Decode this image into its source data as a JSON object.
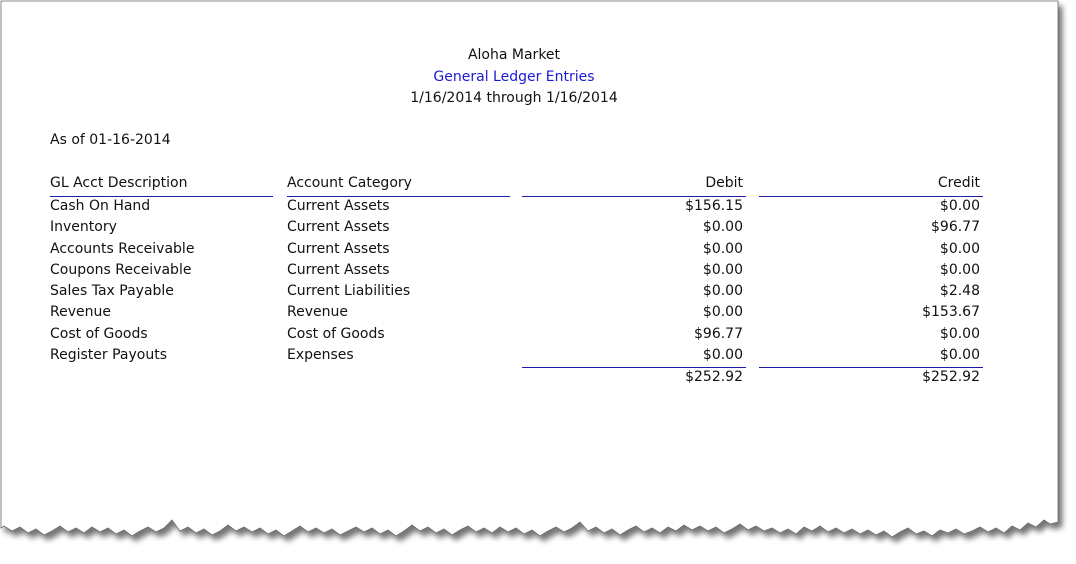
{
  "report": {
    "company": "Aloha Market",
    "title": "General Ledger Entries",
    "date_range": "1/16/2014 through 1/16/2014",
    "as_of": "As of 01-16-2014",
    "title_color": "#1a1ad6",
    "rule_color": "#1c1ca8"
  },
  "columns": {
    "description": "GL Acct Description",
    "category": "Account Category",
    "debit": "Debit",
    "credit": "Credit"
  },
  "rows": [
    {
      "description": "Cash On Hand",
      "category": "Current Assets",
      "debit": "$156.15",
      "credit": "$0.00"
    },
    {
      "description": "Inventory",
      "category": "Current Assets",
      "debit": "$0.00",
      "credit": "$96.77"
    },
    {
      "description": "Accounts Receivable",
      "category": "Current Assets",
      "debit": "$0.00",
      "credit": "$0.00"
    },
    {
      "description": "Coupons Receivable",
      "category": "Current Assets",
      "debit": "$0.00",
      "credit": "$0.00"
    },
    {
      "description": "Sales Tax Payable",
      "category": "Current Liabilities",
      "debit": "$0.00",
      "credit": "$2.48"
    },
    {
      "description": "Revenue",
      "category": "Revenue",
      "debit": "$0.00",
      "credit": "$153.67"
    },
    {
      "description": "Cost of Goods",
      "category": "Cost of Goods",
      "debit": "$96.77",
      "credit": "$0.00"
    },
    {
      "description": "Register Payouts",
      "category": "Expenses",
      "debit": "$0.00",
      "credit": "$0.00"
    }
  ],
  "totals": {
    "debit": "$252.92",
    "credit": "$252.92"
  }
}
